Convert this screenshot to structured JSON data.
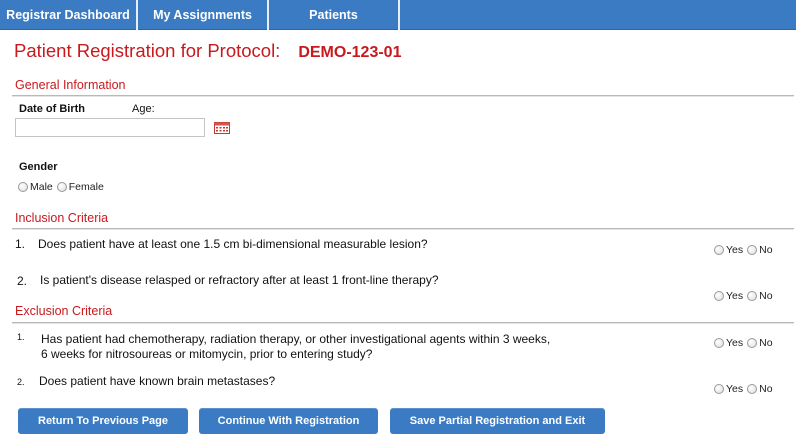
{
  "nav": {
    "tabs": [
      "Registrar Dashboard",
      "My Assignments",
      "Patients"
    ]
  },
  "header": {
    "title": "Patient Registration for Protocol:",
    "protocol_id": "DEMO-123-01"
  },
  "general": {
    "heading": "General Information",
    "dob_label": "Date of Birth",
    "age_label": "Age:",
    "dob_value": "",
    "calendar_icon": "calendar-icon",
    "gender_label": "Gender",
    "gender_options": [
      "Male",
      "Female"
    ]
  },
  "inclusion": {
    "heading": "Inclusion Criteria",
    "questions": [
      {
        "num": "1.",
        "text": "Does patient have at least one 1.5 cm bi-dimensional measurable lesion?"
      },
      {
        "num": "2.",
        "text": "Is patient's disease relasped or refractory after at least 1 front-line therapy?"
      }
    ]
  },
  "exclusion": {
    "heading": "Exclusion Criteria",
    "questions": [
      {
        "num": "1.",
        "text_line1": "Has patient had chemotherapy, radiation therapy, or other investigational agents within 3 weeks,",
        "text_line2": "6 weeks for nitrosoureas or mitomycin, prior to entering study?"
      },
      {
        "num": "2.",
        "text": "Does patient have known brain metastases?"
      }
    ]
  },
  "answer_options": {
    "yes": "Yes",
    "no": "No"
  },
  "buttons": {
    "back": "Return To Previous Page",
    "continue": "Continue With Registration",
    "save_partial": "Save Partial Registration and Exit"
  },
  "colors": {
    "nav_bg": "#3a7bc4",
    "title_red": "#c8191e",
    "button_bg": "#3a7bc4"
  }
}
